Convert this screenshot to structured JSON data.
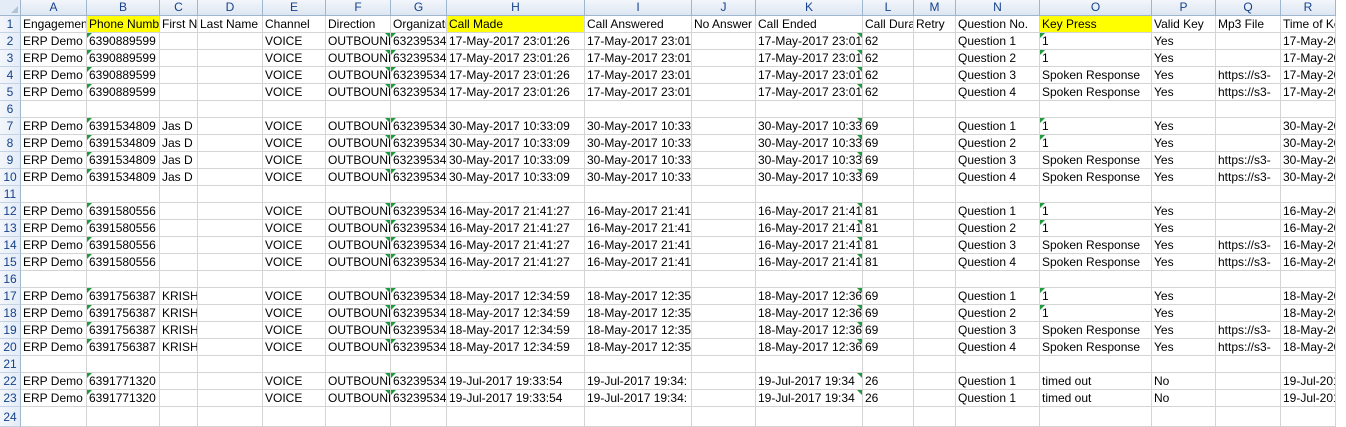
{
  "columns": [
    {
      "letter": "A",
      "header": "Engagement"
    },
    {
      "letter": "B",
      "header": "Phone Number",
      "highlight": true
    },
    {
      "letter": "C",
      "header": "First Name"
    },
    {
      "letter": "D",
      "header": "Last Name"
    },
    {
      "letter": "E",
      "header": "Channel"
    },
    {
      "letter": "F",
      "header": "Direction"
    },
    {
      "letter": "G",
      "header": "Organization"
    },
    {
      "letter": "H",
      "header": "Call Made",
      "highlight": true
    },
    {
      "letter": "I",
      "header": "Call Answered"
    },
    {
      "letter": "J",
      "header": "No Answer"
    },
    {
      "letter": "K",
      "header": "Call Ended"
    },
    {
      "letter": "L",
      "header": "Call Duration"
    },
    {
      "letter": "M",
      "header": "Retry"
    },
    {
      "letter": "N",
      "header": "Question No."
    },
    {
      "letter": "O",
      "header": "Key Press",
      "highlight": true
    },
    {
      "letter": "P",
      "header": "Valid Key"
    },
    {
      "letter": "Q",
      "header": "Mp3 File"
    },
    {
      "letter": "R",
      "header": "Time of Key"
    }
  ],
  "rows": [
    {
      "num": "2",
      "cells": [
        "ERP Demo",
        "6390889599",
        "",
        "",
        "VOICE",
        "OUTBOUND",
        "63239534",
        "17-May-2017 23:01:26",
        "17-May-2017 23:01",
        "",
        "17-May-2017 23:01",
        "62",
        "",
        "Question 1",
        "1",
        "Yes",
        "",
        "17-May-2017"
      ]
    },
    {
      "num": "3",
      "cells": [
        "ERP Demo",
        "6390889599",
        "",
        "",
        "VOICE",
        "OUTBOUND",
        "63239534",
        "17-May-2017 23:01:26",
        "17-May-2017 23:01",
        "",
        "17-May-2017 23:01",
        "62",
        "",
        "Question 2",
        "1",
        "Yes",
        "",
        "17-May-2017"
      ]
    },
    {
      "num": "4",
      "cells": [
        "ERP Demo",
        "6390889599",
        "",
        "",
        "VOICE",
        "OUTBOUND",
        "63239534",
        "17-May-2017 23:01:26",
        "17-May-2017 23:01",
        "",
        "17-May-2017 23:01",
        "62",
        "",
        "Question 3",
        "Spoken Response",
        "Yes",
        "https://s3-",
        "17-May-2017"
      ]
    },
    {
      "num": "5",
      "cells": [
        "ERP Demo",
        "6390889599",
        "",
        "",
        "VOICE",
        "OUTBOUND",
        "63239534",
        "17-May-2017 23:01:26",
        "17-May-2017 23:01",
        "",
        "17-May-2017 23:01",
        "62",
        "",
        "Question 4",
        "Spoken Response",
        "Yes",
        "https://s3-",
        "17-May-2017"
      ]
    },
    {
      "num": "6",
      "cells": [
        "",
        "",
        "",
        "",
        "",
        "",
        "",
        "",
        "",
        "",
        "",
        "",
        "",
        "",
        "",
        "",
        "",
        ""
      ]
    },
    {
      "num": "7",
      "cells": [
        "ERP Demo",
        "6391534809",
        "Jas D",
        "",
        "VOICE",
        "OUTBOUND",
        "63239534",
        "30-May-2017 10:33:09",
        "30-May-2017 10:33",
        "",
        "30-May-2017 10:33",
        "69",
        "",
        "Question 1",
        "1",
        "Yes",
        "",
        "30-May-2017"
      ]
    },
    {
      "num": "8",
      "cells": [
        "ERP Demo",
        "6391534809",
        "Jas D",
        "",
        "VOICE",
        "OUTBOUND",
        "63239534",
        "30-May-2017 10:33:09",
        "30-May-2017 10:33",
        "",
        "30-May-2017 10:33",
        "69",
        "",
        "Question 2",
        "1",
        "Yes",
        "",
        "30-May-2017"
      ]
    },
    {
      "num": "9",
      "cells": [
        "ERP Demo",
        "6391534809",
        "Jas D",
        "",
        "VOICE",
        "OUTBOUND",
        "63239534",
        "30-May-2017 10:33:09",
        "30-May-2017 10:33",
        "",
        "30-May-2017 10:33",
        "69",
        "",
        "Question 3",
        "Spoken Response",
        "Yes",
        "https://s3-",
        "30-May-2017"
      ]
    },
    {
      "num": "10",
      "cells": [
        "ERP Demo",
        "6391534809",
        "Jas D",
        "",
        "VOICE",
        "OUTBOUND",
        "63239534",
        "30-May-2017 10:33:09",
        "30-May-2017 10:33",
        "",
        "30-May-2017 10:33",
        "69",
        "",
        "Question 4",
        "Spoken Response",
        "Yes",
        "https://s3-",
        "30-May-2017"
      ]
    },
    {
      "num": "11",
      "cells": [
        "",
        "",
        "",
        "",
        "",
        "",
        "",
        "",
        "",
        "",
        "",
        "",
        "",
        "",
        "",
        "",
        "",
        ""
      ]
    },
    {
      "num": "12",
      "cells": [
        "ERP Demo",
        "6391580556",
        "",
        "",
        "VOICE",
        "OUTBOUND",
        "63239534",
        "16-May-2017 21:41:27",
        "16-May-2017 21:41",
        "",
        "16-May-2017 21:41",
        "81",
        "",
        "Question 1",
        "1",
        "Yes",
        "",
        "16-May-2017"
      ]
    },
    {
      "num": "13",
      "cells": [
        "ERP Demo",
        "6391580556",
        "",
        "",
        "VOICE",
        "OUTBOUND",
        "63239534",
        "16-May-2017 21:41:27",
        "16-May-2017 21:41",
        "",
        "16-May-2017 21:41",
        "81",
        "",
        "Question 2",
        "1",
        "Yes",
        "",
        "16-May-2017"
      ]
    },
    {
      "num": "14",
      "cells": [
        "ERP Demo",
        "6391580556",
        "",
        "",
        "VOICE",
        "OUTBOUND",
        "63239534",
        "16-May-2017 21:41:27",
        "16-May-2017 21:41",
        "",
        "16-May-2017 21:41",
        "81",
        "",
        "Question 3",
        "Spoken Response",
        "Yes",
        "https://s3-",
        "16-May-2017"
      ]
    },
    {
      "num": "15",
      "cells": [
        "ERP Demo",
        "6391580556",
        "",
        "",
        "VOICE",
        "OUTBOUND",
        "63239534",
        "16-May-2017 21:41:27",
        "16-May-2017 21:41",
        "",
        "16-May-2017 21:41",
        "81",
        "",
        "Question 4",
        "Spoken Response",
        "Yes",
        "https://s3-",
        "16-May-2017"
      ]
    },
    {
      "num": "16",
      "cells": [
        "",
        "",
        "",
        "",
        "",
        "",
        "",
        "",
        "",
        "",
        "",
        "",
        "",
        "",
        "",
        "",
        "",
        ""
      ]
    },
    {
      "num": "17",
      "cells": [
        "ERP Demo",
        "6391756387",
        "KRISH",
        "",
        "VOICE",
        "OUTBOUND",
        "63239534",
        "18-May-2017 12:34:59",
        "18-May-2017 12:35",
        "",
        "18-May-2017 12:36",
        "69",
        "",
        "Question 1",
        "1",
        "Yes",
        "",
        "18-May-2017"
      ]
    },
    {
      "num": "18",
      "cells": [
        "ERP Demo",
        "6391756387",
        "KRISH",
        "",
        "VOICE",
        "OUTBOUND",
        "63239534",
        "18-May-2017 12:34:59",
        "18-May-2017 12:35",
        "",
        "18-May-2017 12:36",
        "69",
        "",
        "Question 2",
        "1",
        "Yes",
        "",
        "18-May-2017"
      ]
    },
    {
      "num": "19",
      "cells": [
        "ERP Demo",
        "6391756387",
        "KRISH",
        "",
        "VOICE",
        "OUTBOUND",
        "63239534",
        "18-May-2017 12:34:59",
        "18-May-2017 12:35",
        "",
        "18-May-2017 12:36",
        "69",
        "",
        "Question 3",
        "Spoken Response",
        "Yes",
        "https://s3-",
        "18-May-2017"
      ]
    },
    {
      "num": "20",
      "cells": [
        "ERP Demo",
        "6391756387",
        "KRISH",
        "",
        "VOICE",
        "OUTBOUND",
        "63239534",
        "18-May-2017 12:34:59",
        "18-May-2017 12:35",
        "",
        "18-May-2017 12:36",
        "69",
        "",
        "Question 4",
        "Spoken Response",
        "Yes",
        "https://s3-",
        "18-May-2017"
      ]
    },
    {
      "num": "21",
      "cells": [
        "",
        "",
        "",
        "",
        "",
        "",
        "",
        "",
        "",
        "",
        "",
        "",
        "",
        "",
        "",
        "",
        "",
        ""
      ]
    },
    {
      "num": "22",
      "cells": [
        "ERP Demo",
        "6391771320",
        "",
        "",
        "VOICE",
        "OUTBOUND",
        "63239534",
        "19-Jul-2017 19:33:54",
        "19-Jul-2017 19:34:",
        "",
        "19-Jul-2017 19:34",
        "26",
        "",
        "Question 1",
        "timed out",
        "No",
        "",
        "19-Jul-2017"
      ]
    },
    {
      "num": "23",
      "cells": [
        "ERP Demo",
        "6391771320",
        "",
        "",
        "VOICE",
        "OUTBOUND",
        "63239534",
        "19-Jul-2017 19:33:54",
        "19-Jul-2017 19:34:",
        "",
        "19-Jul-2017 19:34",
        "26",
        "",
        "Question 1",
        "timed out",
        "No",
        "",
        "19-Jul-2017"
      ]
    },
    {
      "num": "24",
      "cells": [
        "",
        "",
        "",
        "",
        "",
        "",
        "",
        "",
        "",
        "",
        "",
        "",
        "",
        "",
        "",
        "",
        "",
        ""
      ]
    }
  ]
}
